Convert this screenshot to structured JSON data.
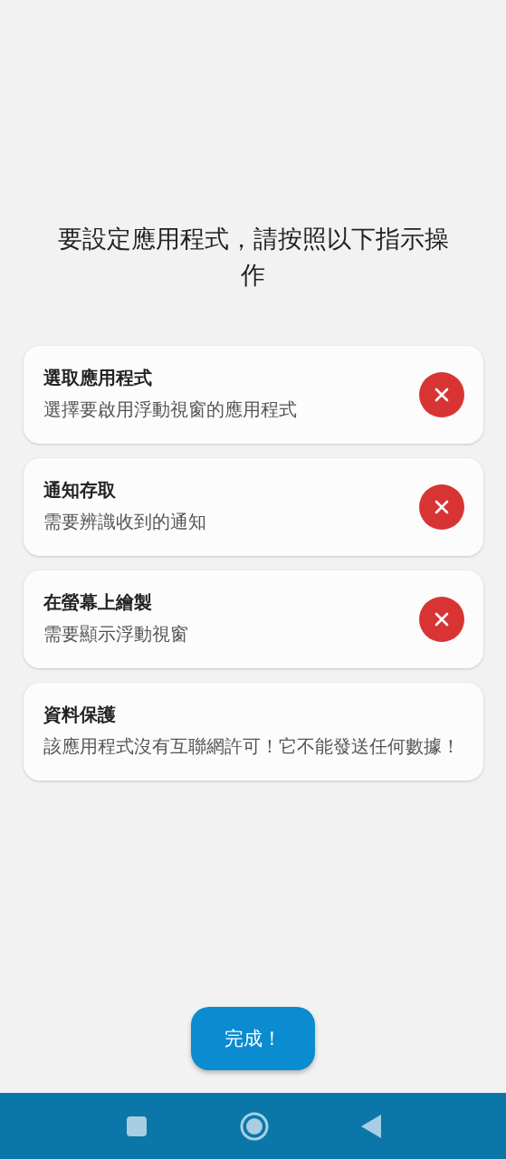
{
  "heading": "要設定應用程式，請按照以下指示操作",
  "cards": [
    {
      "kind": "permission",
      "title": "選取應用程式",
      "description": "選擇要啟用浮動視窗的應用程式",
      "granted": false
    },
    {
      "kind": "permission",
      "title": "通知存取",
      "description": "需要辨識收到的通知",
      "granted": false
    },
    {
      "kind": "permission",
      "title": "在螢幕上繪製",
      "description": "需要顯示浮動視窗",
      "granted": false
    },
    {
      "kind": "info",
      "title": "資料保護",
      "description": "該應用程式沒有互聯網許可！它不能發送任何數據！"
    }
  ],
  "done_button": "完成！"
}
